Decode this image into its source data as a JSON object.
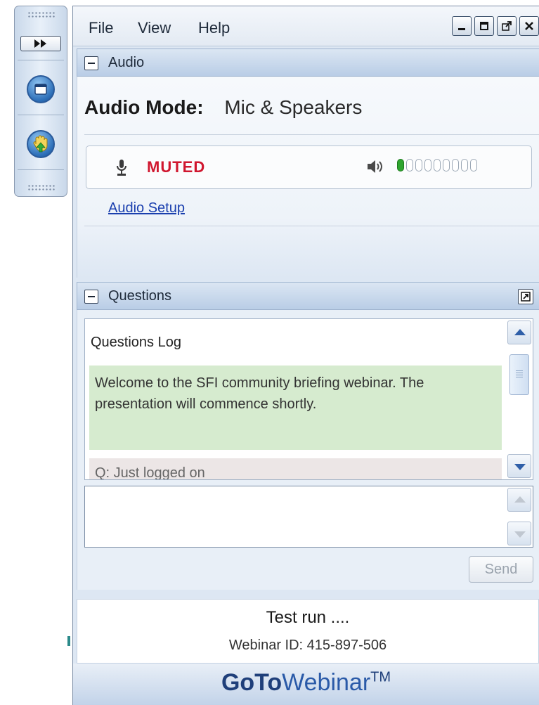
{
  "sidebar": {
    "buttons": [
      {
        "icon": "fast-forward-icon"
      },
      {
        "icon": "screen-icon"
      },
      {
        "icon": "raise-hand-icon"
      }
    ]
  },
  "menu": {
    "items": [
      "File",
      "View",
      "Help"
    ]
  },
  "window_controls": [
    "minimize-icon",
    "maximize-icon",
    "popout-icon",
    "close-icon"
  ],
  "audio": {
    "panel_title": "Audio",
    "mode_label": "Audio Mode:",
    "mode_value": "Mic & Speakers",
    "mic_status": "MUTED",
    "speaker_level": {
      "active": 1,
      "total": 9
    },
    "setup_link": "Audio Setup"
  },
  "questions": {
    "panel_title": "Questions",
    "log_title": "Questions Log",
    "messages": [
      {
        "text": "Welcome to the SFI community briefing webinar. The presentation will commence shortly."
      },
      {
        "text": "Q: Just logged on"
      }
    ],
    "input_value": "",
    "send_label": "Send"
  },
  "session": {
    "title": "Test run ....",
    "webinar_id": "Webinar ID: 415-897-506"
  },
  "brand": {
    "part1": "GoTo",
    "part2": "Webinar",
    "tm": "TM"
  },
  "colors": {
    "muted": "#d0162e",
    "level_on": "#2fa52f",
    "welcome_bg": "#d6ebcf",
    "link": "#1a3fae"
  }
}
